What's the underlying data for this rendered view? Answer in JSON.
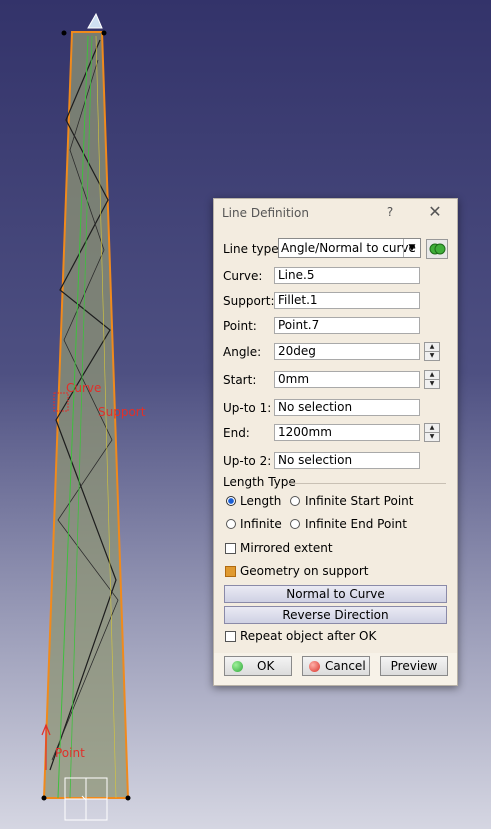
{
  "viewport": {
    "labels": {
      "curve": "Curve",
      "support": "Support",
      "point": "Point"
    }
  },
  "dialog": {
    "title": "Line Definition",
    "help_glyph": "?",
    "close_glyph": "✕",
    "line_type": {
      "label": "Line type :",
      "value": "Angle/Normal to curve",
      "arrow": "▼"
    },
    "curve": {
      "label": "Curve:",
      "value": "Line.5"
    },
    "support": {
      "label": "Support:",
      "value": "Fillet.1"
    },
    "point": {
      "label": "Point:",
      "value": "Point.7"
    },
    "angle": {
      "label": "Angle:",
      "value": "20deg"
    },
    "start": {
      "label": "Start:",
      "value": "0mm"
    },
    "upto1": {
      "label": "Up-to 1:",
      "value": "No selection"
    },
    "end": {
      "label": "End:",
      "value": "1200mm"
    },
    "upto2": {
      "label": "Up-to 2:",
      "value": "No selection"
    },
    "length_type": {
      "legend": "Length Type",
      "options": [
        "Length",
        "Infinite Start Point",
        "Infinite",
        "Infinite End Point"
      ],
      "selected": "Length"
    },
    "mirrored_extent": {
      "label": "Mirrored extent",
      "checked": false
    },
    "geometry_on_support": {
      "label": "Geometry on support",
      "checked": true
    },
    "normal_to_curve_label": "Normal to Curve",
    "reverse_direction_label": "Reverse Direction",
    "repeat_object": {
      "label": "Repeat object after OK",
      "checked": false
    },
    "buttons": {
      "ok": "OK",
      "cancel": "Cancel",
      "preview": "Preview"
    },
    "colors": {
      "ok_dot": "#2fa83a",
      "cancel_dot": "#d8322a",
      "accent": "#e09a30"
    }
  },
  "spin_arrows": {
    "up": "▲",
    "down": "▼"
  }
}
